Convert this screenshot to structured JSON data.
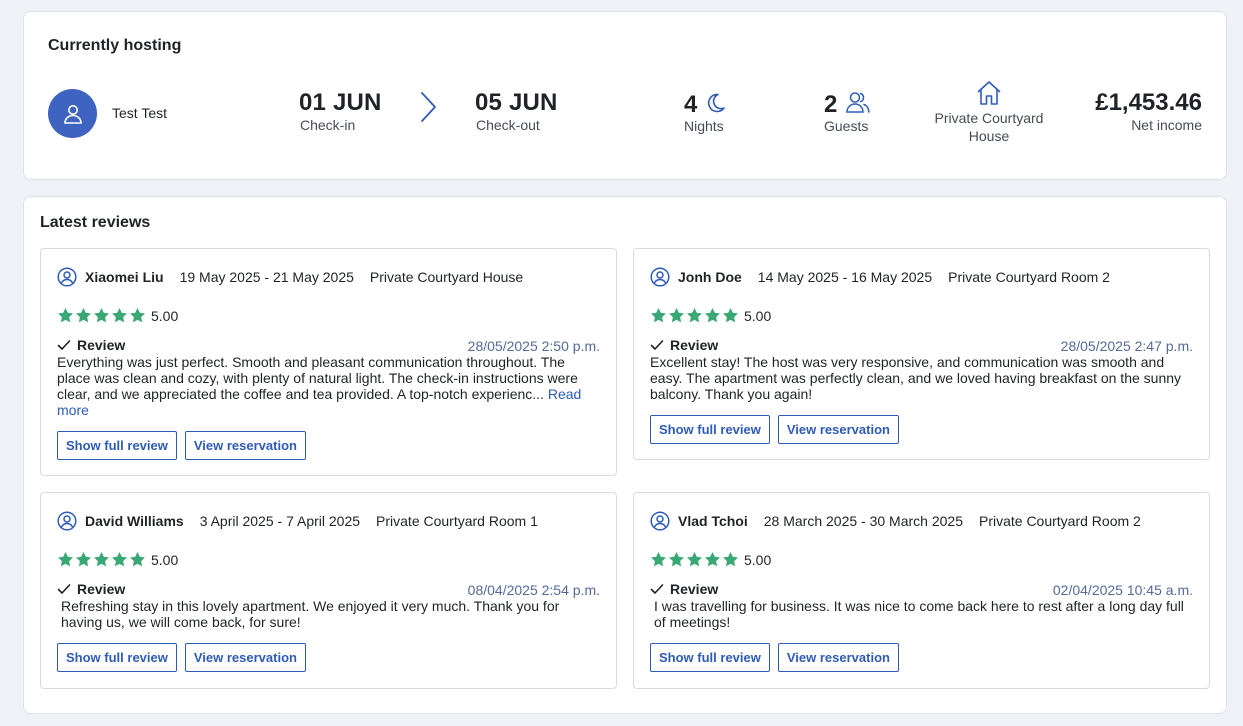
{
  "hosting": {
    "title": "Currently hosting",
    "guest_name": "Test Test",
    "checkin_date": "01 JUN",
    "checkin_label": "Check-in",
    "checkout_date": "05 JUN",
    "checkout_label": "Check-out",
    "nights": "4",
    "nights_label": "Nights",
    "guests": "2",
    "guests_label": "Guests",
    "property": "Private Courtyard House",
    "income": "£1,453.46",
    "income_label": "Net income"
  },
  "reviews": {
    "title": "Latest reviews",
    "review_label": "Review",
    "show_full_label": "Show full review",
    "view_reservation_label": "View reservation",
    "read_more_label": "Read more",
    "items": [
      {
        "name": "Xiaomei Liu",
        "dates": "19 May 2025 - 21 May 2025",
        "property": "Private Courtyard House",
        "score": "5.00",
        "timestamp": "28/05/2025 2:50 p.m.",
        "text": "Everything was just perfect. Smooth and pleasant communication throughout. The place was clean and cozy, with plenty of natural light. The check-in instructions were clear, and we appreciated the coffee and tea provided. A top-notch experienc..."
      },
      {
        "name": "Jonh Doe",
        "dates": "14 May 2025 - 16 May 2025",
        "property": "Private Courtyard Room 2",
        "score": "5.00",
        "timestamp": "28/05/2025 2:47 p.m.",
        "text": "Excellent stay! The host was very responsive, and communication was smooth and easy. The apartment was perfectly clean, and we loved having breakfast on the sunny balcony. Thank you again!"
      },
      {
        "name": "David Williams",
        "dates": "3 April 2025 - 7 April 2025",
        "property": "Private Courtyard Room 1",
        "score": "5.00",
        "timestamp": "08/04/2025 2:54 p.m.",
        "text": "Refreshing stay in this lovely apartment. We enjoyed it very much. Thank you for having us, we will come back, for sure!"
      },
      {
        "name": "Vlad Tchoi",
        "dates": "28 March 2025 - 30 March 2025",
        "property": "Private Courtyard Room 2",
        "score": "5.00",
        "timestamp": "02/04/2025 10:45 a.m.",
        "text": "I was travelling for business. It was nice to come back here to rest after a long day full of meetings!"
      }
    ]
  },
  "colors": {
    "accent": "#2f5bb7",
    "avatar_bg": "#3e63c0",
    "star": "#3aa876",
    "timestamp": "#566a99"
  },
  "icons": [
    "user-icon",
    "chevron-right-icon",
    "moon-icon",
    "users-icon",
    "home-icon",
    "user-circle-icon",
    "star-icon",
    "check-icon"
  ]
}
